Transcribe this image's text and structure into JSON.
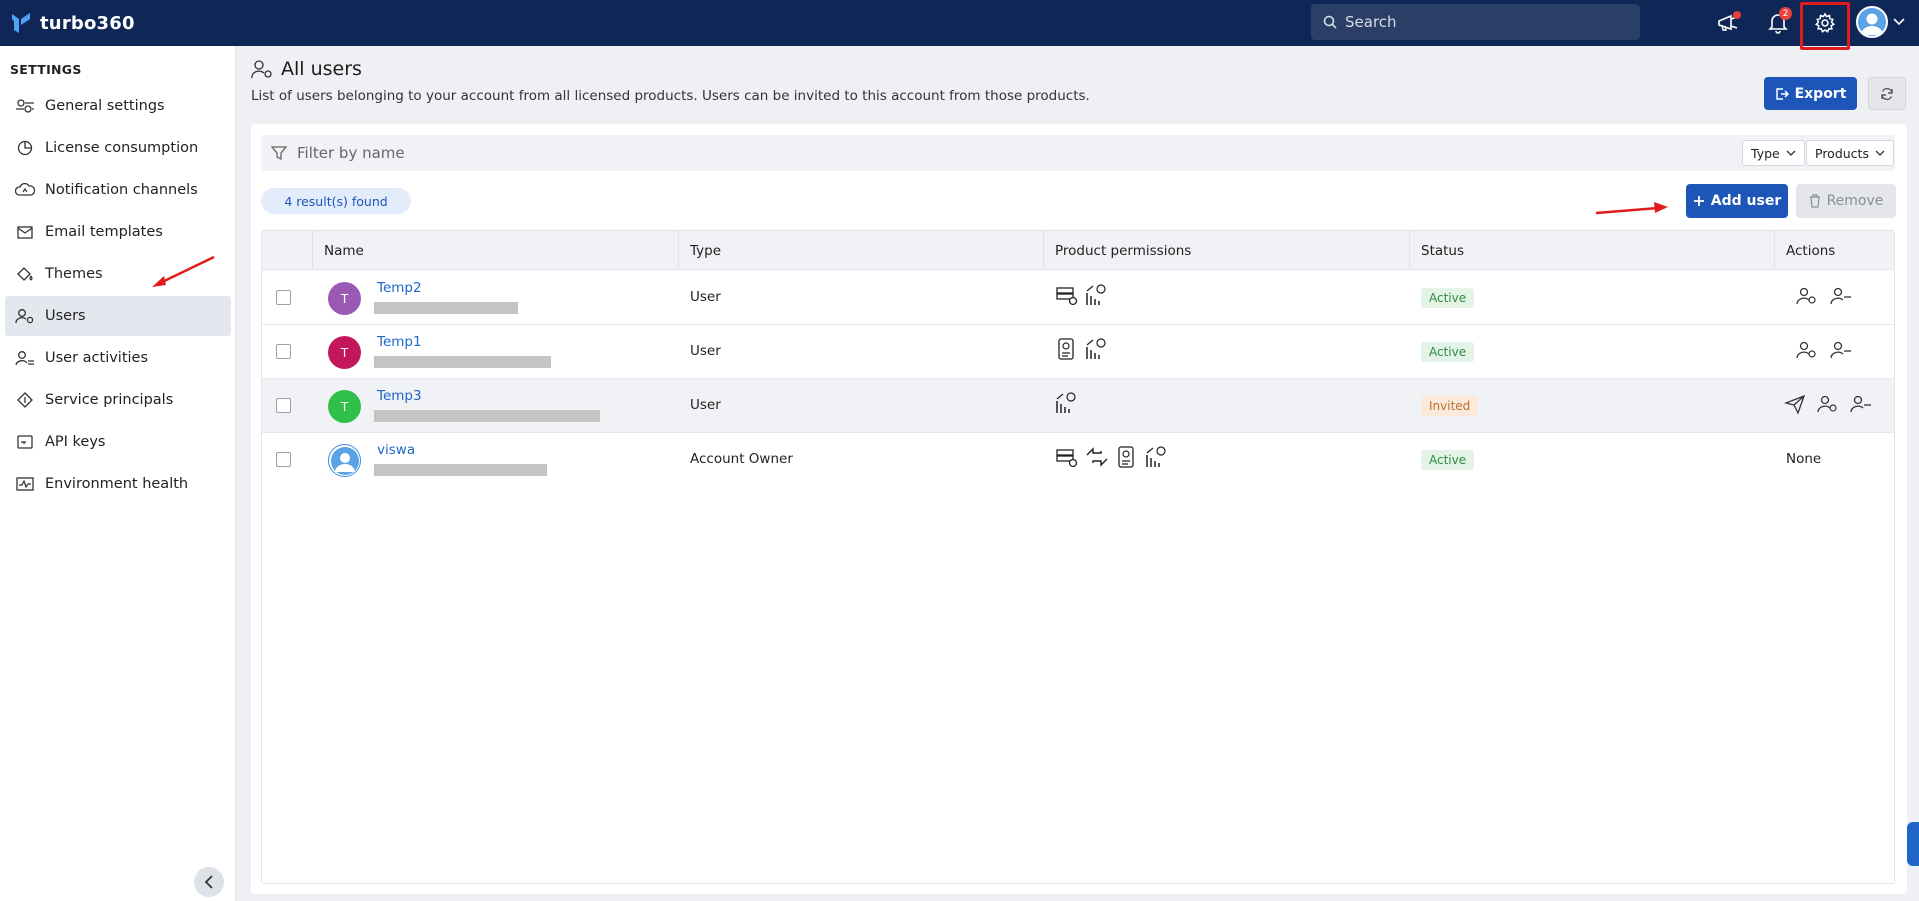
{
  "app": {
    "name": "turbo360"
  },
  "header": {
    "search_placeholder": "Search",
    "notification_count": "2",
    "icons": [
      "announcement-icon",
      "bell-icon",
      "gear-icon",
      "user-avatar-icon",
      "chevron-down-icon"
    ]
  },
  "sidebar": {
    "heading": "SETTINGS",
    "items": [
      {
        "label": "General settings",
        "icon": "settings-sliders-icon"
      },
      {
        "label": "License consumption",
        "icon": "pie-chart-icon"
      },
      {
        "label": "Notification channels",
        "icon": "cloud-bell-icon"
      },
      {
        "label": "Email templates",
        "icon": "envelope-icon"
      },
      {
        "label": "Themes",
        "icon": "paint-bucket-icon"
      },
      {
        "label": "Users",
        "icon": "user-gear-icon",
        "active": true
      },
      {
        "label": "User activities",
        "icon": "user-activity-icon"
      },
      {
        "label": "Service principals",
        "icon": "diamond-key-icon"
      },
      {
        "label": "API keys",
        "icon": "key-icon"
      },
      {
        "label": "Environment health",
        "icon": "pulse-icon"
      }
    ]
  },
  "page": {
    "title": "All users",
    "subtitle": "List of users belonging to your account from all licensed products. Users can be invited to this account from those products.",
    "export_label": "Export"
  },
  "filter": {
    "placeholder": "Filter by name",
    "type_label": "Type",
    "products_label": "Products"
  },
  "results_text": "4 result(s) found",
  "toolbar": {
    "add_label": "Add user",
    "remove_label": "Remove"
  },
  "table": {
    "columns": [
      "Name",
      "Type",
      "Product permissions",
      "Status",
      "Actions"
    ],
    "rows": [
      {
        "initial": "T",
        "name": "Temp2",
        "type": "User",
        "status": "Active",
        "avatar_color": "#9b59b6",
        "actions": "edit-remove"
      },
      {
        "initial": "T",
        "name": "Temp1",
        "type": "User",
        "status": "Active",
        "avatar_color": "#c2185b",
        "actions": "edit-remove"
      },
      {
        "initial": "T",
        "name": "Temp3",
        "type": "User",
        "status": "Invited",
        "avatar_color": "#2fbf4a",
        "actions": "resend-edit-remove"
      },
      {
        "initial": "",
        "name": "viswa",
        "type": "Account Owner",
        "status": "Active",
        "avatar_color": "#ffffff",
        "actions": "None"
      }
    ]
  },
  "colors": {
    "topbar": "#0f2757",
    "primary": "#1e55b8",
    "link": "#1e67c8",
    "annotation_red": "#e01b1b"
  }
}
